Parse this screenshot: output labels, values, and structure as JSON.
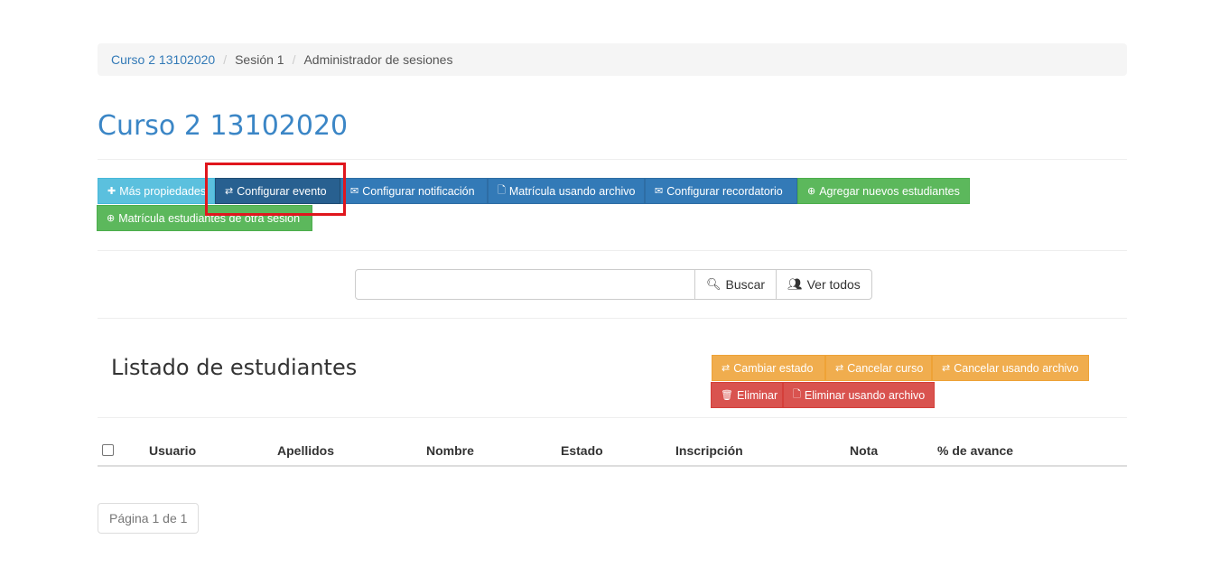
{
  "breadcrumb": {
    "course": "Curso 2 13102020",
    "session": "Sesión 1",
    "current": "Administrador de sesiones",
    "separator": "/"
  },
  "page_title": "Curso 2 13102020",
  "actions": {
    "more_properties": "Más propiedades",
    "configure_event": "Configurar evento",
    "configure_notification": "Configurar notificación",
    "enroll_by_file": "Matrícula usando archivo",
    "configure_reminder": "Configurar recordatorio",
    "add_new_students": "Agregar nuevos estudiantes",
    "enroll_from_other_session": "Matrícula estudiantes de otra sesión"
  },
  "search": {
    "value": "",
    "search_label": "Buscar",
    "view_all_label": "Ver todos"
  },
  "students_section": {
    "title": "Listado de estudiantes",
    "change_status": "Cambiar estado",
    "cancel_course": "Cancelar curso",
    "cancel_by_file": "Cancelar usando archivo",
    "delete": "Eliminar",
    "delete_by_file": "Eliminar usando archivo"
  },
  "table": {
    "headers": [
      "Usuario",
      "Apellidos",
      "Nombre",
      "Estado",
      "Inscripción",
      "Nota",
      "% de avance"
    ]
  },
  "pagination": "Página 1 de 1",
  "icons": {
    "plus": "plus-icon",
    "exchange": "exchange-icon",
    "envelope": "envelope-icon",
    "file": "file-icon",
    "plus_circle": "plus-circle-icon",
    "search": "search-icon",
    "users": "users-icon",
    "trash": "trash-icon"
  },
  "colors": {
    "info": "#5bc0de",
    "primary": "#337ab7",
    "primary_active": "#286090",
    "success": "#5cb85c",
    "warning": "#f0ad4e",
    "danger": "#d9534f",
    "title": "#3b86c6",
    "highlight": "#e0161d"
  }
}
